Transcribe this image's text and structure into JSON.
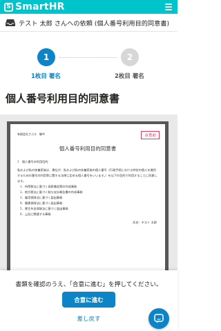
{
  "header": {
    "logo_mark": "S",
    "logo_text": "SmartHR",
    "menu_icon": "hamburger-menu-icon",
    "bg_color": "#00c4cc"
  },
  "request": {
    "icon": "inbox-icon",
    "title": "テスト 太郎 さんへの依頼 (個人番号利用目的同意書)"
  },
  "stepper": {
    "steps": [
      {
        "number": "1",
        "label": "1枚目 署名",
        "active": true
      },
      {
        "number": "2",
        "label": "2枚目 署名",
        "active": false
      }
    ]
  },
  "page": {
    "title": "個人番号利用目的同意書"
  },
  "document": {
    "addressee": "有限会社さぶろ　御中",
    "stamp": "合意前",
    "title": "個人番号利用目的同意書",
    "heading": "1　個人番号の利用目的",
    "paragraph": "私および私の扶養家族は、貴社が、私および私の扶養家族の個人番号（行政手続における特定の個人を識別するための番号の利用等に関する法律に定める個人番号をいいます。）を以下の目的で利用することに同意します。",
    "items": [
      "1．所得税法に基づく源泉徴収票の作成事務",
      "2．地方税法に基づく給与支払報告書の作成事務",
      "3．雇用保険法に基づく届出事務",
      "4．健康保険法に基づく届出事務",
      "5．厚生年金保険法に基づく届出事務",
      "6．上記に関連する事務"
    ],
    "signature": "氏名：テスト 太郎"
  },
  "bottom": {
    "instruction": "書類を確認のうえ、「合意に進む」を押してください。",
    "agree_label": "合意に進む",
    "return_label": "差し戻す"
  },
  "chat": {
    "icon": "chat-icon"
  },
  "colors": {
    "accent": "#0d84c8",
    "inactive": "#d7d7d7",
    "stamp": "#e23b66"
  }
}
